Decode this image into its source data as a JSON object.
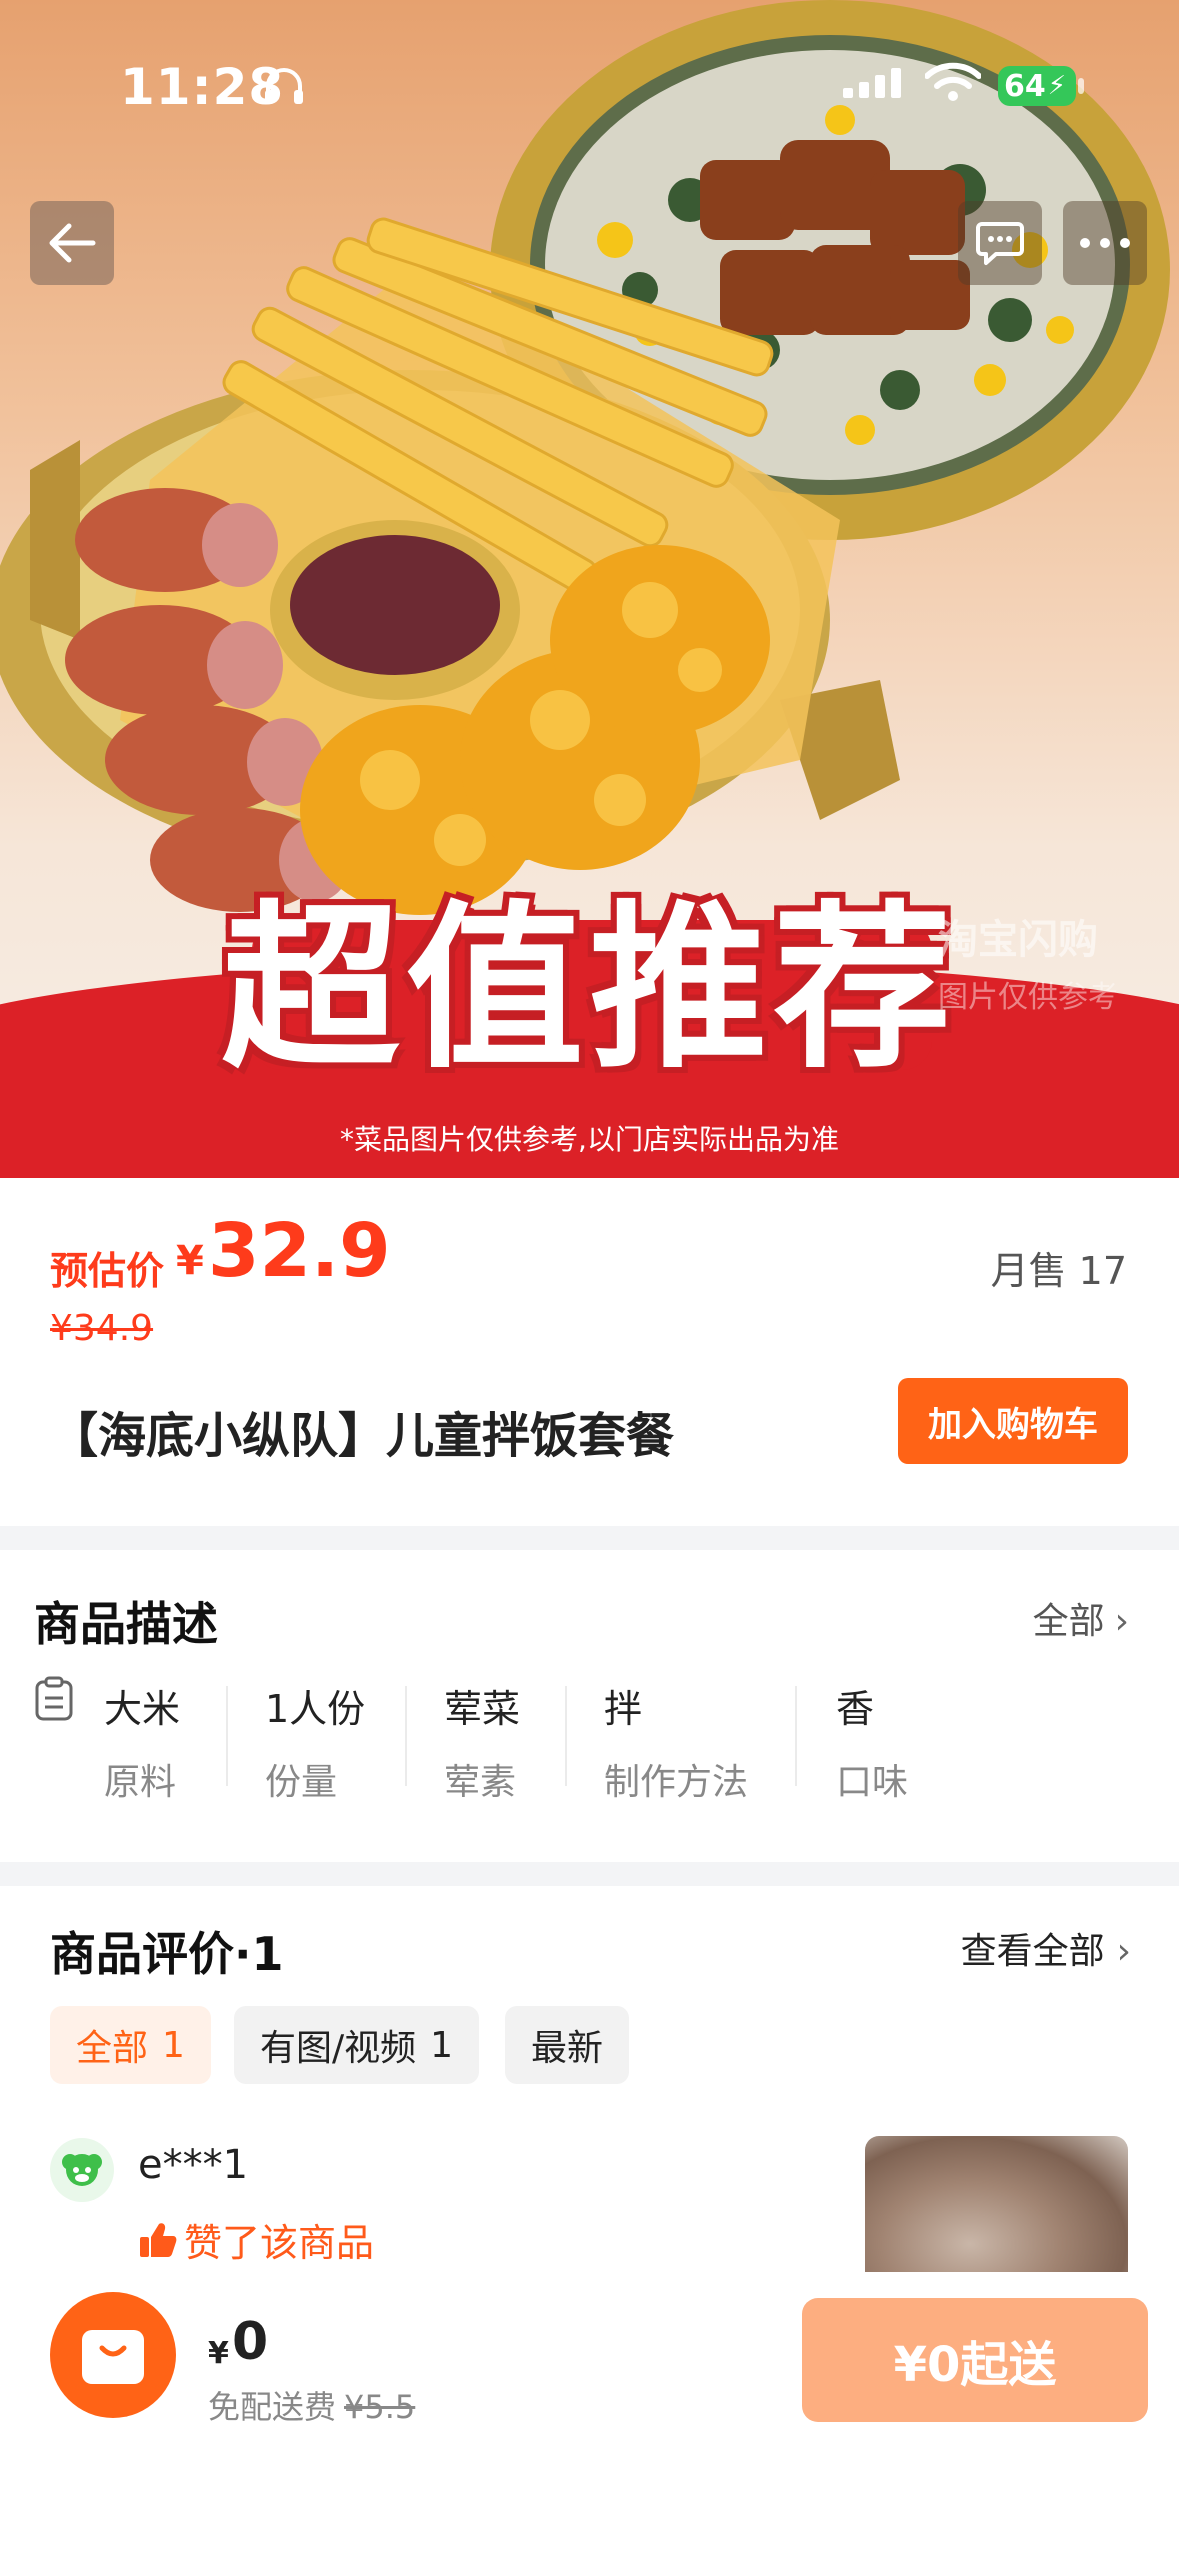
{
  "status_bar": {
    "time": "11:28",
    "battery": "64"
  },
  "nav": {
    "back_icon": "back-arrow-icon",
    "message_icon": "message-icon",
    "more_icon": "more-icon"
  },
  "hero": {
    "banner_title": "超值推荐",
    "banner_note": "*菜品图片仅供参考,以门店实际出品为准",
    "watermark_line1": "淘宝闪购",
    "watermark_line2": "图片仅供参考"
  },
  "product": {
    "price_label": "预估价",
    "currency": "¥",
    "price": "32.9",
    "original_price": "¥34.9",
    "monthly_sales": "月售 17",
    "title": "【海底小纵队】儿童拌饭套餐",
    "add_cart": "加入购物车"
  },
  "description": {
    "title": "商品描述",
    "view_all": "全部",
    "attributes": [
      {
        "value": "大米",
        "key": "原料"
      },
      {
        "value": "1人份",
        "key": "份量"
      },
      {
        "value": "荤菜",
        "key": "荤素"
      },
      {
        "value": "拌",
        "key": "制作方法"
      },
      {
        "value": "香",
        "key": "口味"
      }
    ]
  },
  "reviews": {
    "title": "商品评价·1",
    "view_all": "查看全部",
    "filters": [
      {
        "label": "全部",
        "count": "1"
      },
      {
        "label": "有图/视频",
        "count": "1"
      },
      {
        "label": "最新",
        "count": ""
      }
    ],
    "items": [
      {
        "user": "e***1",
        "liked_text": "赞了该商品"
      }
    ]
  },
  "bottom_bar": {
    "currency": "¥",
    "cart_total": "0",
    "fee_label": "免配送费",
    "fee_original": "¥5.5",
    "min_order": "¥0起送"
  },
  "colors": {
    "accent": "#ff6316",
    "price_red": "#fe3b1b",
    "banner_red": "#dc2127",
    "disabled_orange": "#fdae80"
  }
}
